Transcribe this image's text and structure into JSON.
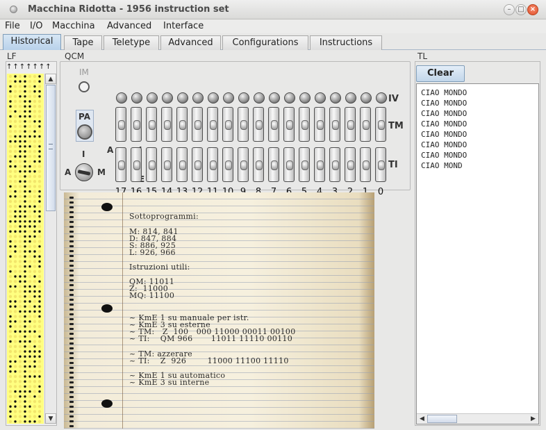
{
  "window": {
    "title": "Macchina Ridotta - 1956 instruction set"
  },
  "menu": [
    "File",
    "I/O",
    "Macchina",
    "Advanced",
    "Interface"
  ],
  "tabs": [
    {
      "label": "Historical",
      "active": true
    },
    {
      "label": "Tape",
      "active": false
    },
    {
      "label": "Teletype",
      "active": false
    },
    {
      "label": "Advanced",
      "active": false
    },
    {
      "label": "Configurations",
      "active": false
    },
    {
      "label": "Instructions",
      "active": false
    }
  ],
  "lf": {
    "label": "LF",
    "arrows": "↑↑↑↑↑↑↑",
    "tape_color": "#ffff80"
  },
  "qcm": {
    "label": "QCM",
    "im_label": "IM",
    "pa_label": "PA",
    "iv_label": "IV",
    "tm_label": "TM",
    "ti_label": "TI",
    "a_top": "A",
    "i_top": "I",
    "e_label": "E",
    "knob_i": "I",
    "knob_a": "A",
    "knob_m": "M",
    "bit_numbers": [
      "17",
      "16",
      "15",
      "14",
      "13",
      "12",
      "11",
      "10",
      "9",
      "8",
      "7",
      "6",
      "5",
      "4",
      "3",
      "2",
      "1",
      "0"
    ]
  },
  "notepad": {
    "lines": [
      "Sottoprogrammi:",
      "M: 814, 841",
      "D: 847, 884",
      "S: 886, 925",
      "L: 926, 966",
      "Istruzioni utili:",
      "QM: 11011",
      "Z:  11000",
      "MQ: 11100",
      "~ KmE 1 su manuale per istr.",
      "~ KmE 3 su esterne",
      "~ TM:   Z  100   000 11000 00011 00100",
      "~ TI:    QM 966       11011 11110 00110",
      "~ TM: azzerare",
      "~ TI:    Z  926        11000 11100 11110",
      "~ KmE 1 su automatico",
      "~ KmE 3 su interne"
    ]
  },
  "tl": {
    "label": "TL",
    "clear_label": "Clear",
    "output": [
      "CIAO MONDO",
      "CIAO MONDO",
      "CIAO MONDO",
      "CIAO MONDO",
      "CIAO MONDO",
      "CIAO MONDO",
      "CIAO MONDO",
      "CIAO MOND"
    ]
  }
}
